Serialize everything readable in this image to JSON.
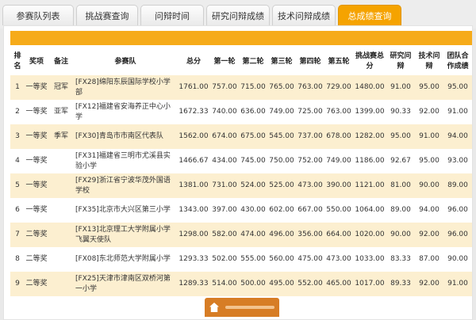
{
  "tabs": [
    {
      "label": "参赛队列表",
      "active": false
    },
    {
      "label": "挑战赛查询",
      "active": false
    },
    {
      "label": "问辩时间",
      "active": false
    },
    {
      "label": "研究问辩成绩",
      "active": false
    },
    {
      "label": "技术问辩成绩",
      "active": false
    },
    {
      "label": "总成绩查询",
      "active": true
    }
  ],
  "columns": [
    "排名",
    "奖项",
    "备注",
    "参赛队",
    "总分",
    "第一轮",
    "第二轮",
    "第三轮",
    "第四轮",
    "第五轮",
    "挑战赛总分",
    "研究问辩",
    "技术问辩",
    "团队合作成绩"
  ],
  "rows": [
    [
      "1",
      "一等奖",
      "冠军",
      "[FX28]绵阳东辰国际学校小学部",
      "1761.00",
      "757.00",
      "715.00",
      "765.00",
      "763.00",
      "729.00",
      "1480.00",
      "91.00",
      "95.00",
      "95.00"
    ],
    [
      "2",
      "一等奖",
      "亚军",
      "[FX12]福建省安海养正中心小学",
      "1672.33",
      "740.00",
      "636.00",
      "749.00",
      "725.00",
      "763.00",
      "1399.00",
      "90.33",
      "92.00",
      "91.00"
    ],
    [
      "3",
      "一等奖",
      "季军",
      "[FX30]青岛市市南区代表队",
      "1562.00",
      "674.00",
      "675.00",
      "545.00",
      "737.00",
      "678.00",
      "1282.00",
      "95.00",
      "91.00",
      "94.00"
    ],
    [
      "4",
      "一等奖",
      "",
      "[FX31]福建省三明市尤溪县实验小学",
      "1466.67",
      "434.00",
      "745.00",
      "750.00",
      "752.00",
      "749.00",
      "1186.00",
      "92.67",
      "95.00",
      "93.00"
    ],
    [
      "5",
      "一等奖",
      "",
      "[FX29]浙江省宁波华茂外国语学校",
      "1381.00",
      "731.00",
      "524.00",
      "525.00",
      "473.00",
      "390.00",
      "1121.00",
      "81.00",
      "90.00",
      "89.00"
    ],
    [
      "6",
      "一等奖",
      "",
      "[FX35]北京市大兴区第三小学",
      "1343.00",
      "397.00",
      "430.00",
      "602.00",
      "667.00",
      "550.00",
      "1064.00",
      "89.00",
      "94.00",
      "96.00"
    ],
    [
      "7",
      "二等奖",
      "",
      "[FX13]北京理工大学附属小学飞翼天使队",
      "1298.00",
      "582.00",
      "474.00",
      "496.00",
      "356.00",
      "664.00",
      "1020.00",
      "90.00",
      "92.00",
      "96.00"
    ],
    [
      "8",
      "二等奖",
      "",
      "[FX08]东北师范大学附属小学",
      "1293.33",
      "502.00",
      "555.00",
      "560.00",
      "475.00",
      "473.00",
      "1033.00",
      "83.33",
      "87.00",
      "90.00"
    ],
    [
      "9",
      "二等奖",
      "",
      "[FX25]天津市津南区双桥河第一小学",
      "1289.33",
      "514.00",
      "500.00",
      "495.00",
      "552.00",
      "465.00",
      "1017.00",
      "89.33",
      "92.00",
      "91.00"
    ]
  ]
}
